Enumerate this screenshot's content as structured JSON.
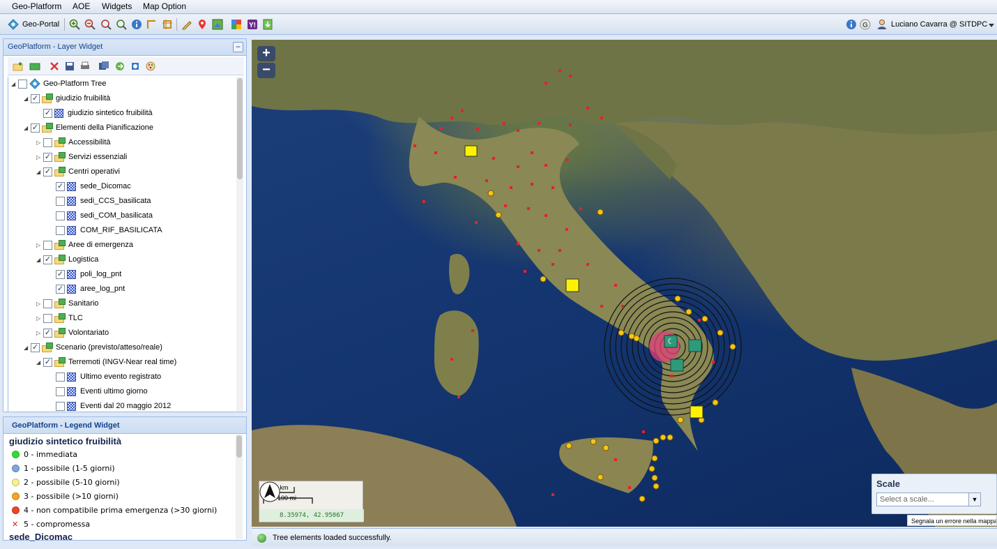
{
  "menu": {
    "items": [
      "Geo-Platform",
      "AOE",
      "Widgets",
      "Map Option"
    ]
  },
  "toolbar": {
    "app_label": "Geo-Portal",
    "user_label": "Luciano Cavarra @ SITDPC",
    "left_icons": [
      "geoportal-logo-icon",
      "zoom-in-icon",
      "zoom-out-icon",
      "zoom-previous-icon",
      "zoom-next-icon",
      "info-icon",
      "measure-icon",
      "measure-area-icon",
      "edit-pencil-icon",
      "map-pin-icon",
      "google-earth-icon",
      "google-maps-icon",
      "yahoo-icon",
      "download-icon"
    ],
    "right_icons": [
      "info-icon",
      "google-icon",
      "user-icon",
      "dropdown-icon"
    ]
  },
  "layer_widget": {
    "title": "GeoPlatform - Layer Widget",
    "collapse": "−",
    "tools": [
      "add-folder-icon",
      "add-layer-icon",
      "delete-icon",
      "save-icon",
      "print-icon",
      "save-all-icon",
      "export-icon",
      "copy-icon",
      "paint-icon"
    ],
    "tree": [
      {
        "label": "Geo-Platform Tree",
        "level": 0,
        "type": "root",
        "checked": false,
        "expanded": true
      },
      {
        "label": "giudizio fruibilità",
        "level": 1,
        "type": "folder",
        "checked": true,
        "expanded": true
      },
      {
        "label": "giudizio sintetico fruibilità",
        "level": 2,
        "type": "layer",
        "checked": true
      },
      {
        "label": "Elementi della Pianificazione",
        "level": 1,
        "type": "folder",
        "checked": true,
        "expanded": true
      },
      {
        "label": "Accessibilità",
        "level": 2,
        "type": "folder",
        "checked": false,
        "expanded": false
      },
      {
        "label": "Servizi essenziali",
        "level": 2,
        "type": "folder",
        "checked": true,
        "expanded": false
      },
      {
        "label": "Centri operativi",
        "level": 2,
        "type": "folder",
        "checked": true,
        "expanded": true
      },
      {
        "label": "sede_Dicomac",
        "level": 3,
        "type": "layer",
        "checked": true
      },
      {
        "label": "sedi_CCS_basilicata",
        "level": 3,
        "type": "layer",
        "checked": false
      },
      {
        "label": "sedi_COM_basilicata",
        "level": 3,
        "type": "layer",
        "checked": false
      },
      {
        "label": "COM_RIF_BASILICATA",
        "level": 3,
        "type": "layer",
        "checked": false
      },
      {
        "label": "Aree di emergenza",
        "level": 2,
        "type": "folder",
        "checked": false,
        "expanded": false
      },
      {
        "label": "Logistica",
        "level": 2,
        "type": "folder",
        "checked": true,
        "expanded": true
      },
      {
        "label": "poli_log_pnt",
        "level": 3,
        "type": "layer",
        "checked": true
      },
      {
        "label": "aree_log_pnt",
        "level": 3,
        "type": "layer",
        "checked": true
      },
      {
        "label": "Sanitario",
        "level": 2,
        "type": "folder",
        "checked": false,
        "expanded": false
      },
      {
        "label": "TLC",
        "level": 2,
        "type": "folder",
        "checked": false,
        "expanded": false
      },
      {
        "label": "Volontariato",
        "level": 2,
        "type": "folder",
        "checked": true,
        "expanded": false
      },
      {
        "label": "Scenario (previsto/atteso/reale)",
        "level": 1,
        "type": "folder",
        "checked": true,
        "expanded": true
      },
      {
        "label": "Terremoti (INGV-Near real time)",
        "level": 2,
        "type": "folder",
        "checked": true,
        "expanded": true
      },
      {
        "label": "Ultimo evento registrato",
        "level": 3,
        "type": "layer",
        "checked": false
      },
      {
        "label": "Eventi ultimo giorno",
        "level": 3,
        "type": "layer",
        "checked": false
      },
      {
        "label": "Eventi dal 20 maggio 2012",
        "level": 3,
        "type": "layer",
        "checked": false
      }
    ]
  },
  "legend_widget": {
    "title": "GeoPlatform - Legend Widget",
    "heading": "giudizio sintetico fruibilità",
    "items": [
      {
        "label": "0 - immediata",
        "color": "#33dd33",
        "shape": "dot"
      },
      {
        "label": "1 - possibile (1-5 giorni)",
        "color": "#7ea6e0",
        "shape": "dot"
      },
      {
        "label": "2 - possibile (5-10 giorni)",
        "color": "#f3f58a",
        "shape": "dot"
      },
      {
        "label": "3 - possibile (>10 giorni)",
        "color": "#f5a623",
        "shape": "dot"
      },
      {
        "label": "4 - non compatibile prima emergenza (>30 giorni)",
        "color": "#e8472b",
        "shape": "dot"
      },
      {
        "label": "5 - compromessa",
        "color": "#cc2222",
        "shape": "x"
      }
    ],
    "next_heading": "sede_Dicomac"
  },
  "map": {
    "zoom_in": "+",
    "zoom_out": "−",
    "scale_km": "100 km",
    "scale_mi": "100 mi",
    "coords": "8.35974, 42.95067",
    "scale_widget": {
      "title": "Scale",
      "placeholder": "Select a scale..."
    },
    "error_link": "Segnala un errore nella mappa"
  },
  "status": {
    "text": "Tree elements loaded successfully."
  }
}
